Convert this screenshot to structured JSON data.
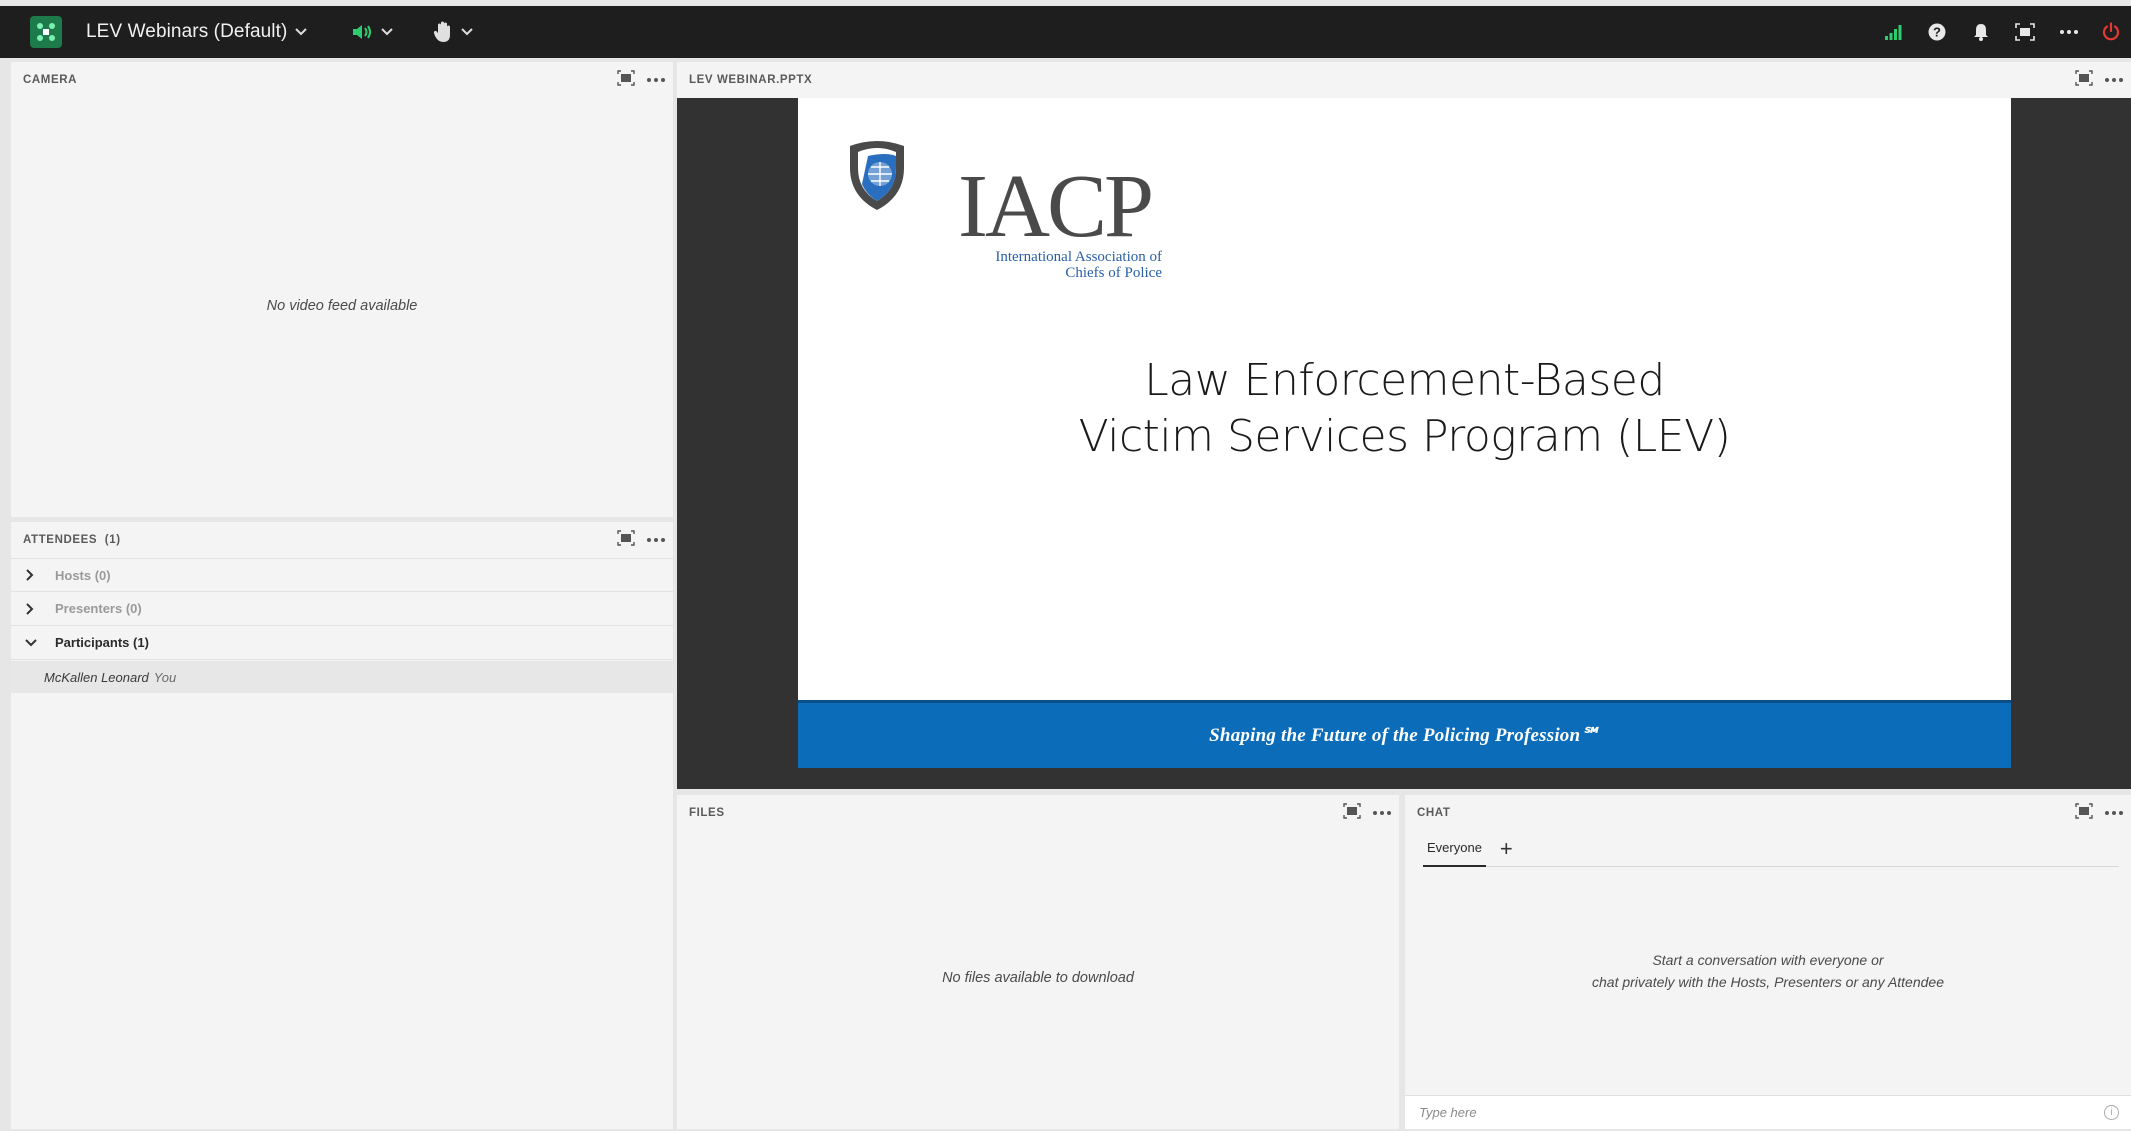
{
  "topbar": {
    "room_name": "LEV Webinars (Default)",
    "icons": [
      "app-logo-icon",
      "speaker-icon",
      "raise-hand-icon",
      "signal-icon",
      "help-icon",
      "notification-icon",
      "fullscreen-icon",
      "more-icon",
      "power-icon"
    ]
  },
  "camera_pod": {
    "title": "CAMERA",
    "empty_message": "No video feed available"
  },
  "attendees_pod": {
    "title": "ATTENDEES  (1)",
    "groups": [
      {
        "label": "Hosts (0)",
        "expanded": false
      },
      {
        "label": "Presenters (0)",
        "expanded": false
      },
      {
        "label": "Participants (1)",
        "expanded": true
      }
    ],
    "participant": {
      "name": "McKallen Leonard",
      "suffix": "You"
    }
  },
  "share_pod": {
    "title": "LEV WEBINAR.PPTX",
    "slide": {
      "logo_text": "IACP",
      "logo_sub_line1": "International Association of",
      "logo_sub_line2": "Chiefs of Police",
      "title_line1": "Law Enforcement-Based",
      "title_line2": "Victim Services Program (LEV)",
      "banner": "Shaping the Future of the Policing Profession℠"
    }
  },
  "files_pod": {
    "title": "FILES",
    "empty_message": "No files available to download"
  },
  "chat_pod": {
    "title": "CHAT",
    "tab_label": "Everyone",
    "add_tab": "+",
    "empty_line1": "Start a conversation with everyone or",
    "empty_line2": "chat privately with the Hosts, Presenters or any Attendee",
    "input_placeholder": "Type here",
    "info_glyph": "i"
  },
  "colors": {
    "topbar_bg": "#1e1e1e",
    "accent_green": "#2ecc71",
    "power_red": "#e53935",
    "banner_blue": "#0b6cb9"
  }
}
